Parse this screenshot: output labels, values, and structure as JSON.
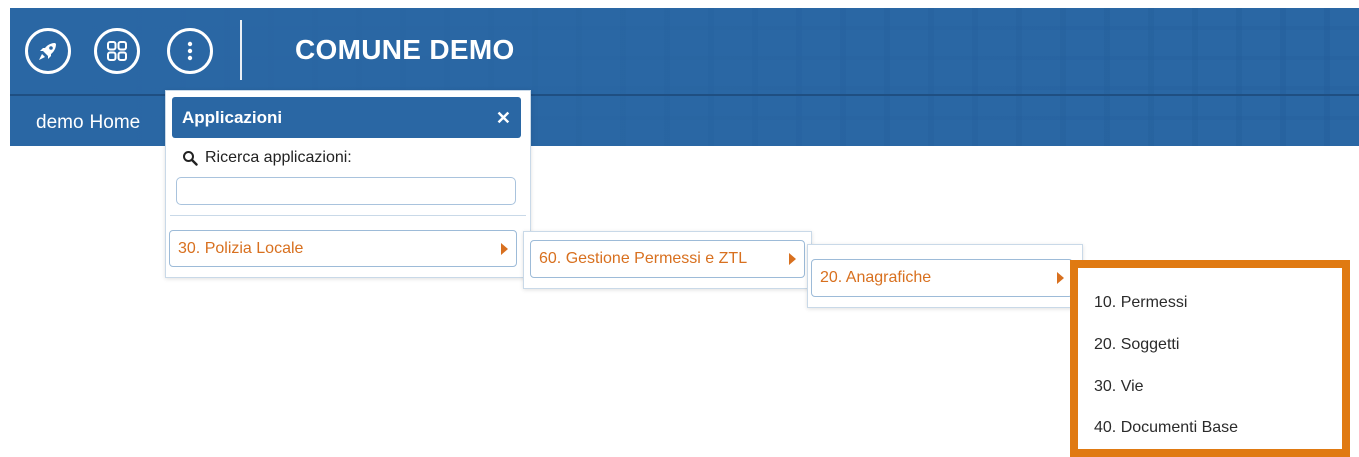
{
  "header": {
    "title": "COMUNE DEMO",
    "buttons": [
      {
        "icon": "rocket-icon"
      },
      {
        "icon": "apps-grid-icon"
      },
      {
        "icon": "more-vertical-icon"
      }
    ],
    "colors": {
      "bar": "#2a67a4",
      "accent": "#d8701f",
      "highlight_border": "#e07a12"
    }
  },
  "tabs": {
    "user": "demo",
    "home": "Home"
  },
  "apps_panel": {
    "title": "Applicazioni",
    "close": "✕",
    "search_label": "Ricerca applicazioni:",
    "search_value": "",
    "search_placeholder": "",
    "item": "30. Polizia Locale"
  },
  "submenu_1": {
    "item": "60. Gestione Permessi e ZTL"
  },
  "submenu_2": {
    "item": "20. Anagrafiche"
  },
  "submenu_3": {
    "items": [
      "10. Permessi",
      "20. Soggetti",
      "30. Vie",
      "40. Documenti Base"
    ]
  }
}
